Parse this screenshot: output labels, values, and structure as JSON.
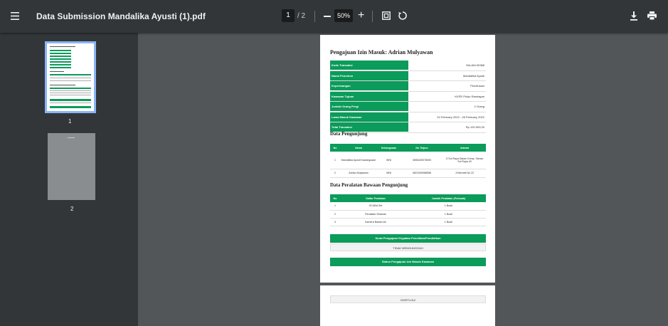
{
  "toolbar": {
    "title": "Data Submission Mandalika Ayusti (1).pdf",
    "page_current": "1",
    "page_total": "/ 2",
    "zoom": "50%",
    "zoom_plus": "+"
  },
  "sidebar": {
    "thumbnails": [
      {
        "number": "1"
      },
      {
        "number": "2"
      }
    ]
  },
  "document": {
    "title": "Pengajuan Izin Masuk: Adrian Mulyawan",
    "info": [
      {
        "label": "Kode Transaksi",
        "value": "SALAM-00388"
      },
      {
        "label": "Nama Pemohon",
        "value": "Mandalika Ayusti"
      },
      {
        "label": "Keperluangan",
        "value": "Penelusian"
      },
      {
        "label": "Kawasan Tujuan",
        "value": "KKPD Pulau Randayan"
      },
      {
        "label": "Jumlah Orang Pergi",
        "value": "2 Orang"
      },
      {
        "label": "Lama Masuk Kawasan",
        "value": "24 February 2022 - 28 February 2022"
      },
      {
        "label": "Total Transaksi",
        "value": "Rp 120.000,00"
      }
    ],
    "visitors_title": "Data Pengunjung",
    "visitors_headers": [
      "No",
      "Nama",
      "Kebangsaan",
      "No Telpon",
      "Alamat"
    ],
    "visitors": [
      {
        "no": "1",
        "nama": "Mandalika Ayusti Kawangusan",
        "kebangsaan": "WNI",
        "telpon": "0896430078505",
        "alamat": "Jl Sui Raya Dalam Komp. Taman Sui Raya 40"
      },
      {
        "no": "2",
        "nama": "Adrian Mulyawan",
        "kebangsaan": "WNI",
        "telpon": "0821549088558",
        "alamat": "Jl Merantl No 22"
      }
    ],
    "equipment_title": "Data Peralatan Bawaan Pengunjung",
    "equipment_headers": [
      "No",
      "Daftar Peralatan",
      "Jumlah Peralatan (Perbuah)"
    ],
    "equipment": [
      {
        "no": "1",
        "nama": "SCUBA Set",
        "jumlah": "1 Buah"
      },
      {
        "no": "2",
        "nama": "Peralatan Selamar",
        "jumlah": "1 Buah"
      },
      {
        "no": "3",
        "nama": "Kamera Bawah Air",
        "jumlah": "1 Buah"
      }
    ],
    "letter_bar": "Surat Pengajuan Kegiatan Penelitian/Pendidikan",
    "letter_value": "TIDAK MENGUNGGAH",
    "status_bar": "Status Pengajuan Izin Masuk Kawasan",
    "page2_status": "DISETUJUI"
  },
  "colors": {
    "toolbar_bg": "#323639",
    "viewer_bg": "#525659",
    "accent_green": "#0b9b5a",
    "thumb_highlight": "#8ab4f8"
  }
}
